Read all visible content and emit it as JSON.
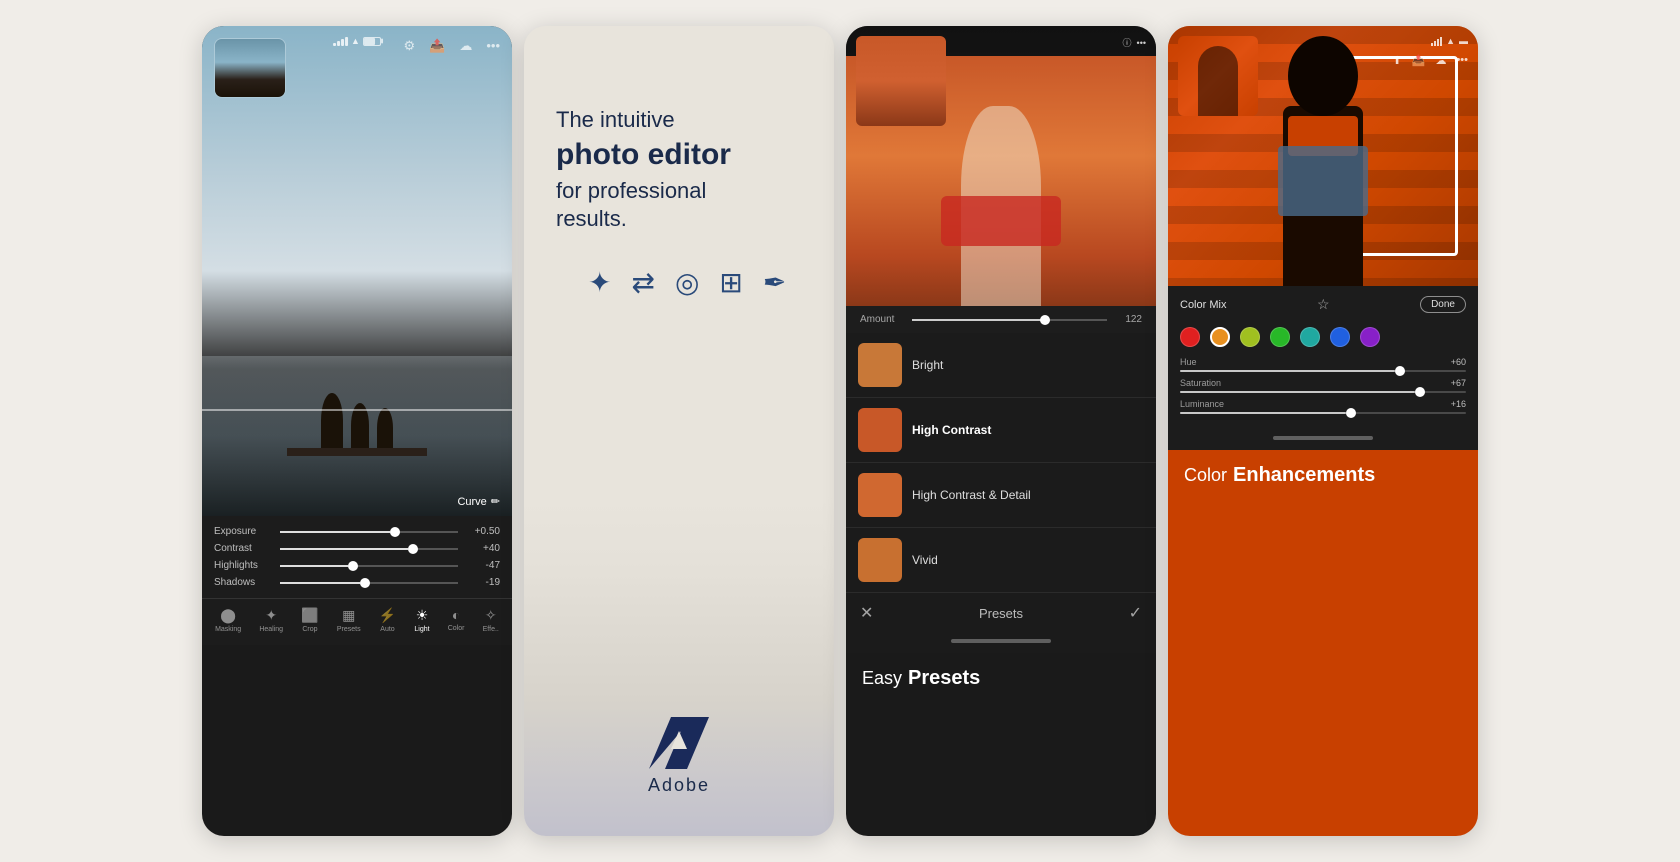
{
  "cards": [
    {
      "id": "card-1",
      "type": "photo-editor",
      "sliders": [
        {
          "label": "Exposure",
          "value": "+0.50",
          "fill_pct": 62
        },
        {
          "label": "Contrast",
          "value": "+40",
          "fill_pct": 72
        },
        {
          "label": "Highlights",
          "value": "-47",
          "fill_pct": 38
        },
        {
          "label": "Shadows",
          "value": "-19",
          "fill_pct": 45
        }
      ],
      "curve_label": "Curve",
      "nav_items": [
        {
          "label": "Masking",
          "icon": "⬤"
        },
        {
          "label": "Healing",
          "icon": "✦"
        },
        {
          "label": "Crop",
          "icon": "⬜"
        },
        {
          "label": "Presets",
          "icon": "▦"
        },
        {
          "label": "Auto",
          "icon": "⚡"
        },
        {
          "label": "Light",
          "icon": "☀",
          "active": true
        },
        {
          "label": "Color",
          "icon": "◐"
        },
        {
          "label": "Effe..",
          "icon": "✧"
        }
      ]
    },
    {
      "id": "card-2",
      "subtitle": "The intuitive",
      "title": "photo editor",
      "desc": "for professional\nresults.",
      "adobe_text": "Adobe"
    },
    {
      "id": "card-3",
      "amount_label": "Amount",
      "amount_value": "122",
      "presets": [
        {
          "name": "Bright"
        },
        {
          "name": "High Contrast",
          "selected": true
        },
        {
          "name": "High Contrast & Detail"
        },
        {
          "name": "Vivid"
        }
      ],
      "bottom_label": "Presets",
      "caption_normal": "Easy",
      "caption_bold": "Presets"
    },
    {
      "id": "card-4",
      "section_title": "Color Mix",
      "done_label": "Done",
      "colors": [
        "#e02020",
        "#e89020",
        "#a0c020",
        "#28b828",
        "#20a8a0",
        "#2060e0",
        "#8820c8"
      ],
      "sliders": [
        {
          "label": "Hue",
          "value": "+60",
          "fill_pct": 75
        },
        {
          "label": "Saturation",
          "value": "+67",
          "fill_pct": 82
        },
        {
          "label": "Luminance",
          "value": "+16",
          "fill_pct": 58
        }
      ],
      "caption_normal": "Color",
      "caption_bold": "Enhancements"
    }
  ]
}
